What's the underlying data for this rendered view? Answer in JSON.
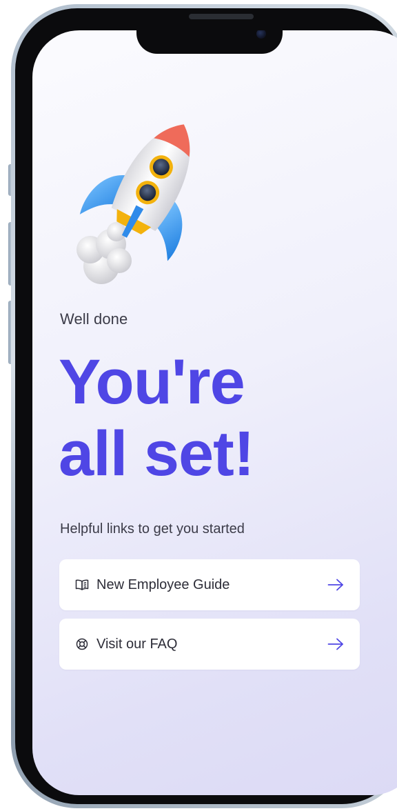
{
  "onboarding": {
    "eyebrow": "Well done",
    "headline_line1": "You're",
    "headline_line2": "all set!",
    "links_heading": "Helpful links to get you started",
    "links": [
      {
        "label": "New Employee Guide",
        "icon": "book-icon"
      },
      {
        "label": "Visit our FAQ",
        "icon": "lifebuoy-icon"
      }
    ]
  },
  "theme": {
    "accent": "#4f46e5",
    "text": "#2d2d38",
    "background_top": "#fbfbfe",
    "background_bottom": "#dcdaf5"
  }
}
